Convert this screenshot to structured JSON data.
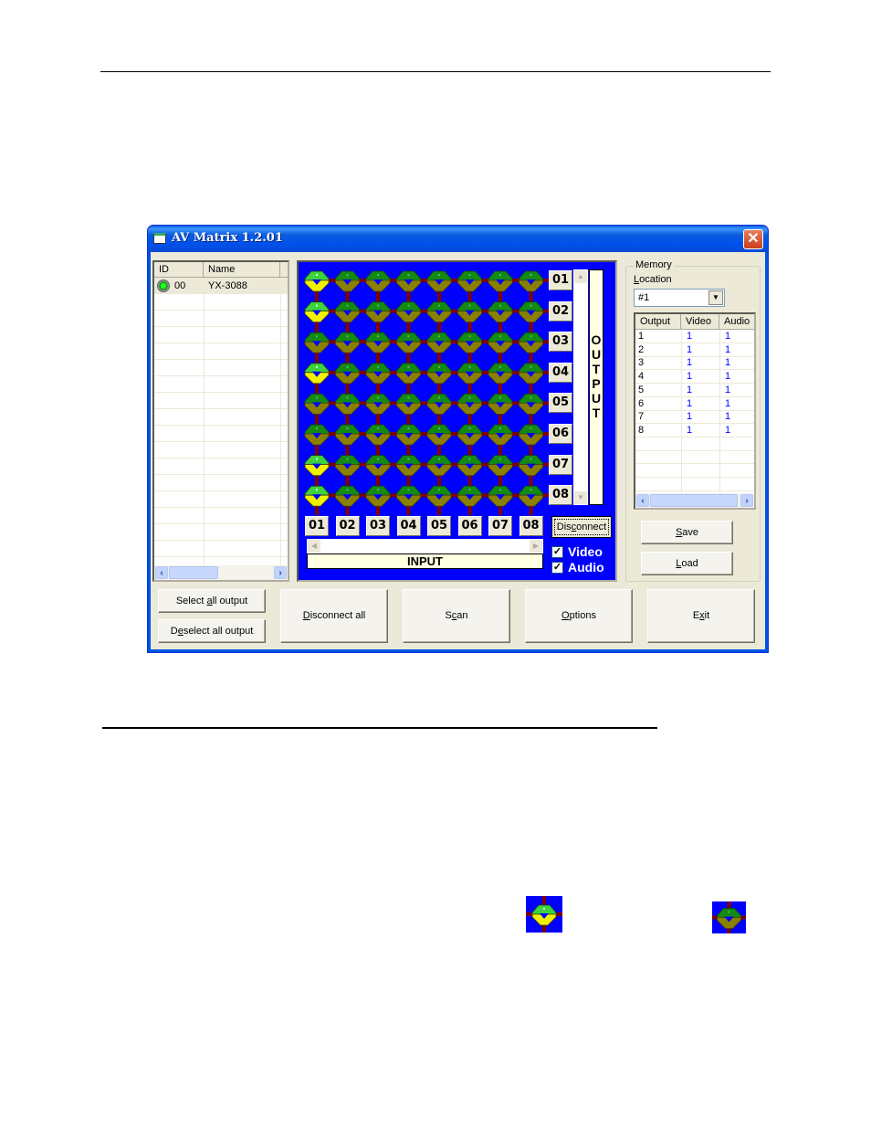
{
  "window": {
    "title": "AV Matrix 1.2.01",
    "close_label": "✕"
  },
  "device_list": {
    "columns": [
      "ID",
      "Name"
    ],
    "rows": [
      {
        "id": "00",
        "name": "YX-3088",
        "status": "connected"
      }
    ]
  },
  "matrix": {
    "output_labels": [
      "01",
      "02",
      "03",
      "04",
      "05",
      "06",
      "07",
      "08"
    ],
    "input_labels": [
      "01",
      "02",
      "03",
      "04",
      "05",
      "06",
      "07",
      "08"
    ],
    "output_caption": "OUTPUT",
    "input_caption": "INPUT",
    "active_routes": [
      {
        "output": 1,
        "input": 1
      },
      {
        "output": 2,
        "input": 1
      },
      {
        "output": 4,
        "input": 1
      },
      {
        "output": 7,
        "input": 1
      },
      {
        "output": 8,
        "input": 1
      }
    ],
    "colors": {
      "background": "#0000fe",
      "link": "#800000",
      "node_top_active": "#3ed23e",
      "node_bottom_active": "#f2f200",
      "node_top_idle": "#138a13",
      "node_bottom_idle": "#8a8000"
    },
    "disconnect_label": "Disconnect",
    "disconnect_mnemonic": "c",
    "video_checkbox": {
      "label": "Video",
      "checked": true
    },
    "audio_checkbox": {
      "label": "Audio",
      "checked": true
    }
  },
  "memory": {
    "group_label": "Memory",
    "location_label": "Location",
    "location_value": "#1",
    "columns": [
      "Output",
      "Video",
      "Audio"
    ],
    "rows": [
      {
        "output": "1",
        "video": "1",
        "audio": "1"
      },
      {
        "output": "2",
        "video": "1",
        "audio": "1"
      },
      {
        "output": "3",
        "video": "1",
        "audio": "1"
      },
      {
        "output": "4",
        "video": "1",
        "audio": "1"
      },
      {
        "output": "5",
        "video": "1",
        "audio": "1"
      },
      {
        "output": "6",
        "video": "1",
        "audio": "1"
      },
      {
        "output": "7",
        "video": "1",
        "audio": "1"
      },
      {
        "output": "8",
        "video": "1",
        "audio": "1"
      }
    ],
    "save_label": "Save",
    "load_label": "Load"
  },
  "buttons": {
    "select_all": {
      "pre": "Select ",
      "key": "a",
      "post": "ll output"
    },
    "deselect_all": {
      "pre": "D",
      "key": "e",
      "post": "select all output"
    },
    "disconnect_all": {
      "pre": "",
      "key": "D",
      "post": "isconnect all"
    },
    "scan": {
      "pre": "S",
      "key": "c",
      "post": "an"
    },
    "options": {
      "pre": "",
      "key": "O",
      "post": "ptions"
    },
    "exit": {
      "pre": "E",
      "key": "x",
      "post": "it"
    }
  },
  "legend_icons": [
    {
      "name": "connected-node-icon",
      "state": "active"
    },
    {
      "name": "disconnected-node-icon",
      "state": "idle"
    }
  ]
}
